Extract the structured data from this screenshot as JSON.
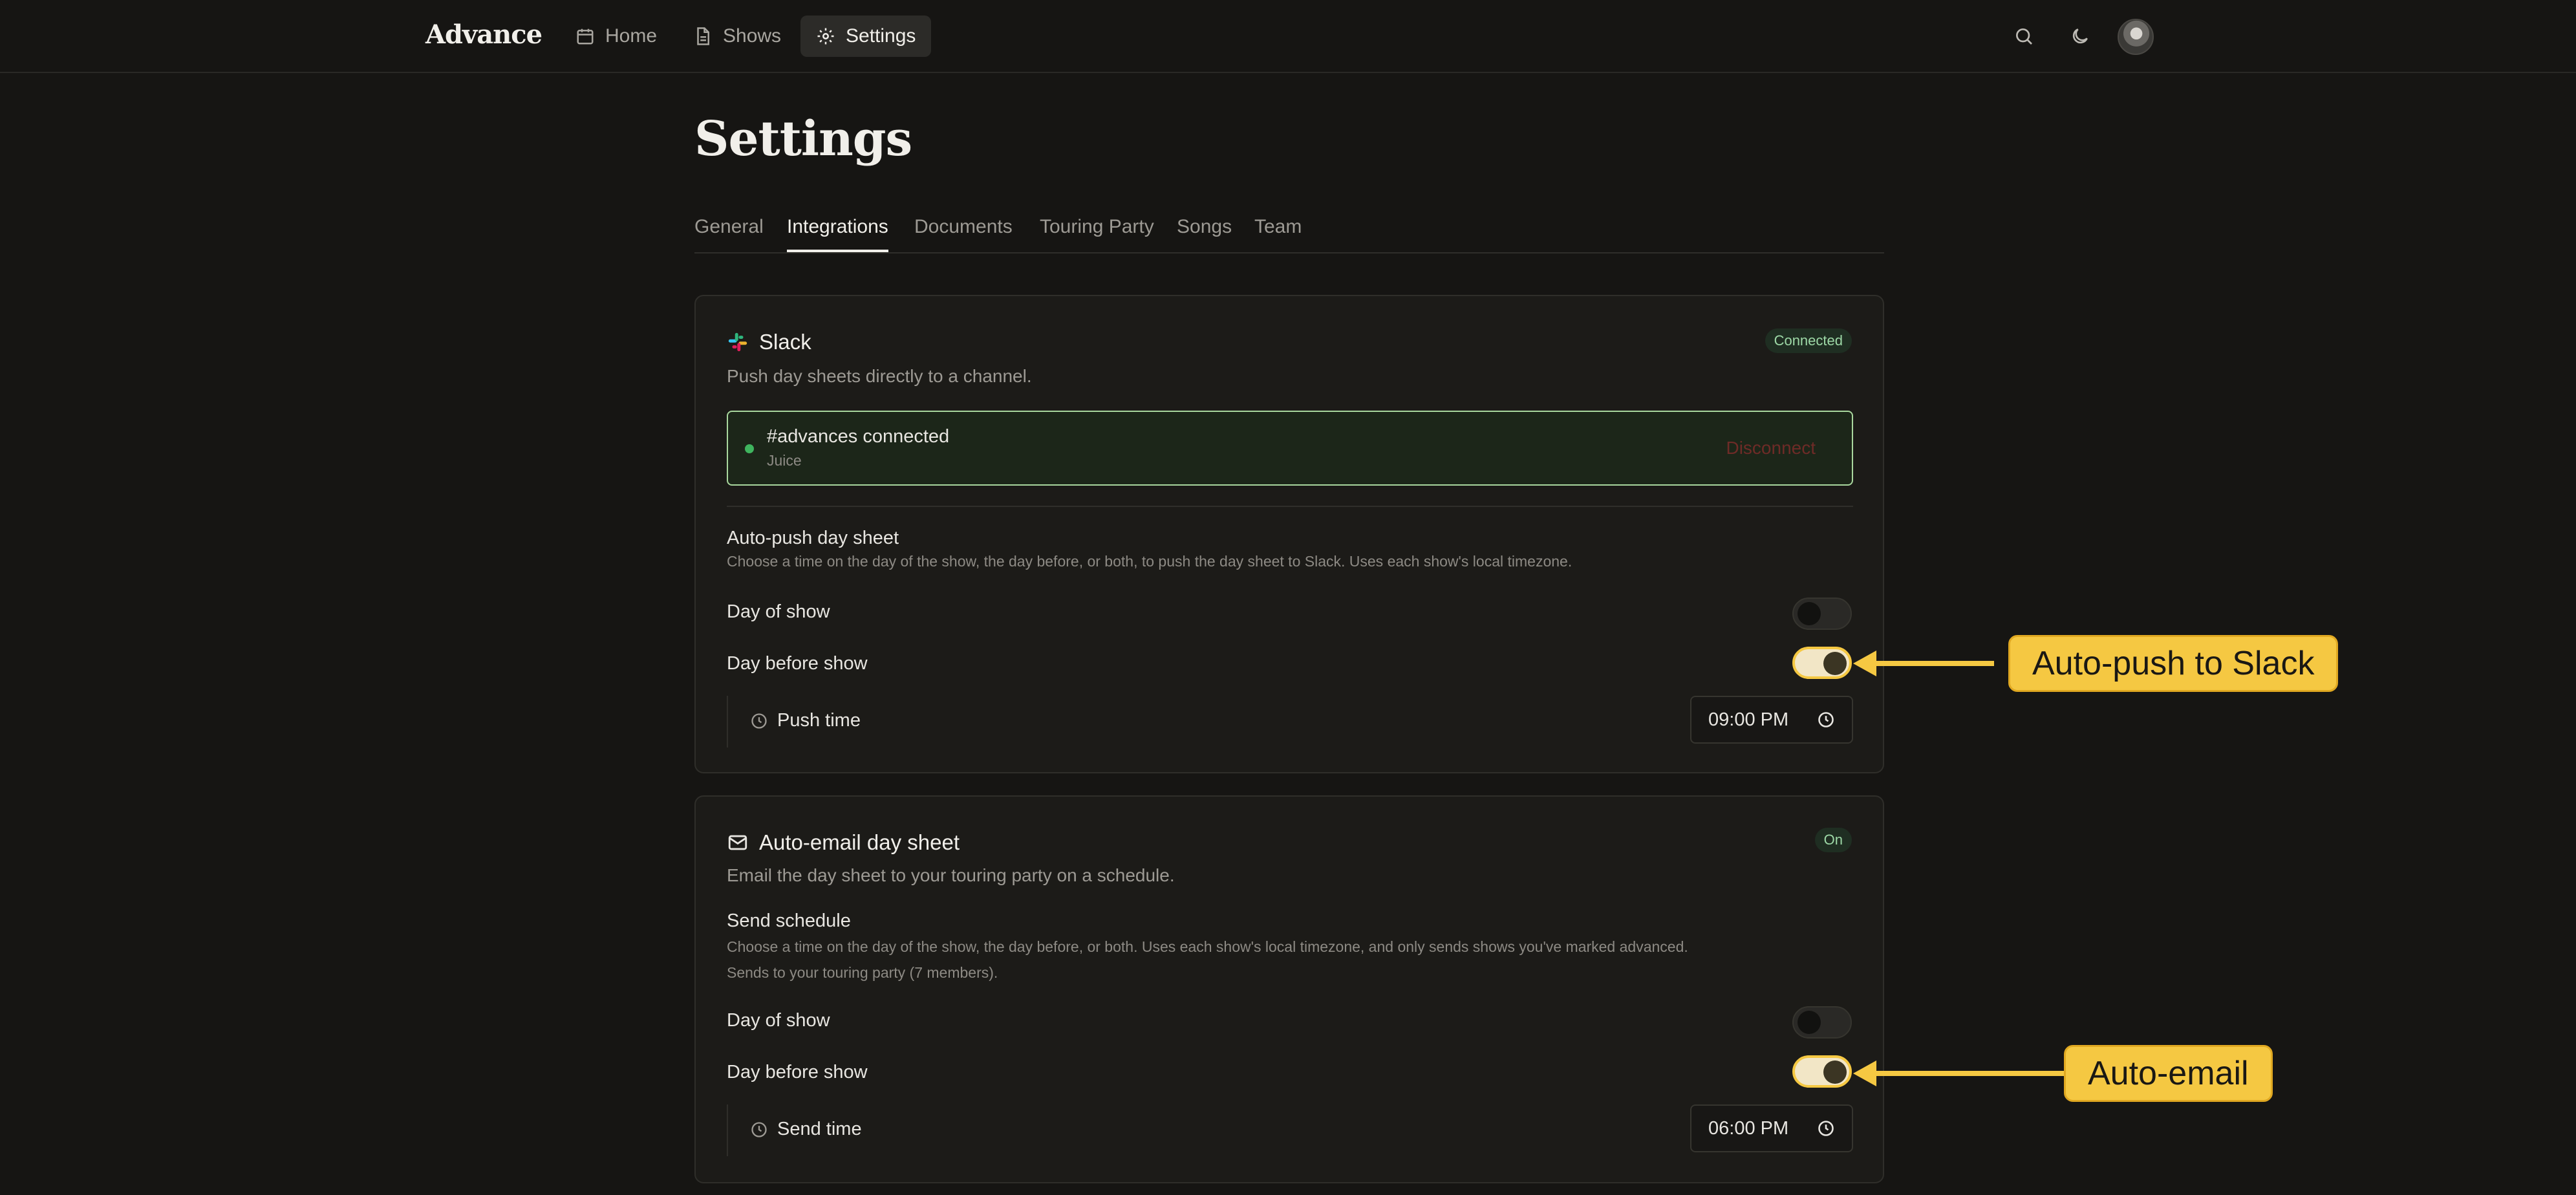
{
  "app": {
    "brand": "Advance"
  },
  "nav": {
    "items": [
      {
        "label": "Home"
      },
      {
        "label": "Shows"
      },
      {
        "label": "Settings"
      }
    ]
  },
  "page": {
    "title": "Settings"
  },
  "tabs": [
    {
      "label": "General"
    },
    {
      "label": "Integrations",
      "active": true
    },
    {
      "label": "Documents"
    },
    {
      "label": "Touring Party"
    },
    {
      "label": "Songs"
    },
    {
      "label": "Team"
    }
  ],
  "slack": {
    "title": "Slack",
    "badge": "Connected",
    "subtitle": "Push day sheets directly to a channel.",
    "channel": "#advances connected",
    "workspace": "Juice",
    "disconnect_label": "Disconnect",
    "autopush": {
      "label": "Auto-push day sheet",
      "description": "Choose a time on the day of the show, the day before, or both, to push the day sheet to Slack. Uses each show's local timezone.",
      "day_of_show": {
        "label": "Day of show",
        "on": false
      },
      "day_before_show": {
        "label": "Day before show",
        "on": true
      },
      "push_time": {
        "label": "Push time",
        "value": "09:00 PM"
      }
    }
  },
  "email": {
    "title": "Auto-email day sheet",
    "badge": "On",
    "subtitle": "Email the day sheet to your touring party on a schedule.",
    "schedule": {
      "label": "Send schedule",
      "description_line1": "Choose a time on the day of the show, the day before, or both. Uses each show's local timezone, and only sends shows you've marked advanced.",
      "description_line2": "Sends to your touring party (7 members).",
      "day_of_show": {
        "label": "Day of show",
        "on": false
      },
      "day_before_show": {
        "label": "Day before show",
        "on": true
      },
      "send_time": {
        "label": "Send time",
        "value": "06:00 PM"
      }
    }
  },
  "annotations": {
    "slack_callout": "Auto-push to Slack",
    "email_callout": "Auto-email"
  },
  "colors": {
    "background": "#161513",
    "accent_callout": "#f5c842",
    "connected_border": "#a9d79e",
    "status_dot": "#3fb45e"
  }
}
